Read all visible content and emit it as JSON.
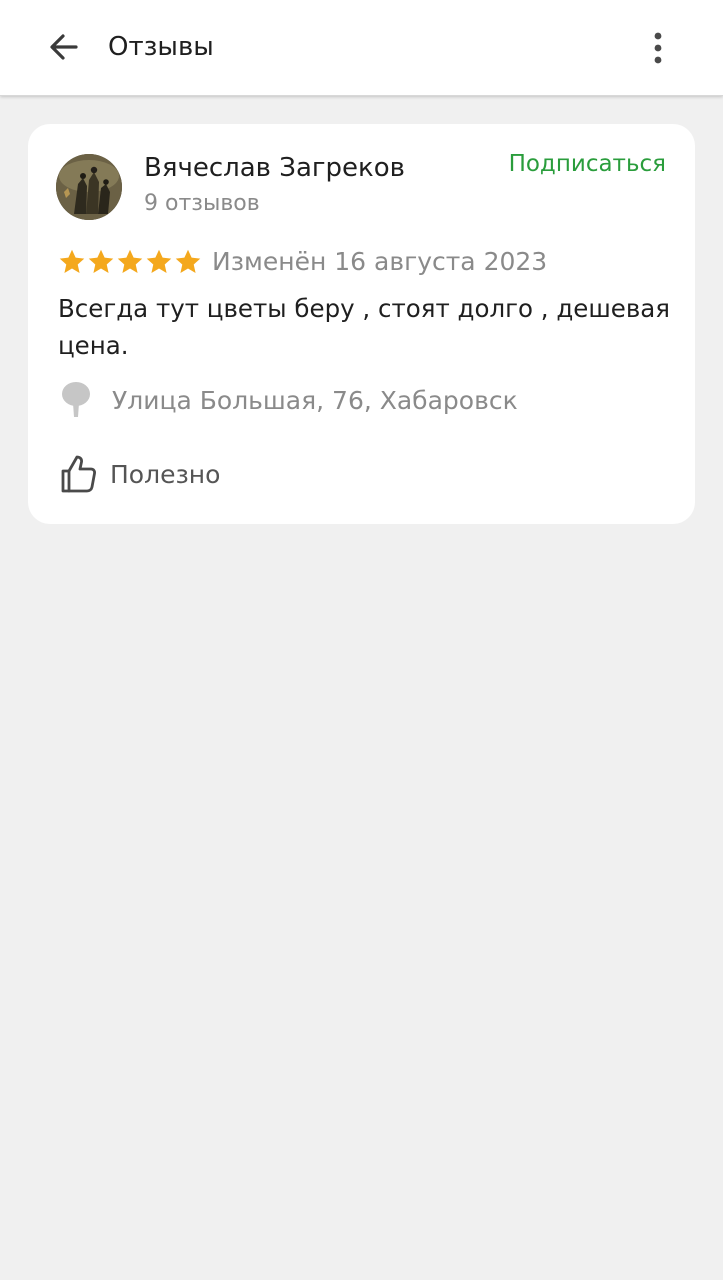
{
  "header": {
    "title": "Отзывы",
    "back_icon": "arrow-left-icon",
    "menu_icon": "more-vertical-icon"
  },
  "review": {
    "author": {
      "name": "Вячеслав Загреков",
      "reviews_count": "9 отзывов",
      "avatar": "user-avatar"
    },
    "subscribe_label": "Подписаться",
    "rating": 5,
    "rating_max": 5,
    "date": "Изменён 16 августа 2023",
    "text": "Всегда тут цветы беру , стоят долго , дешевая цена.",
    "organization": "Улица Большая, 76, Хабаровск",
    "useful_label": "Полезно"
  },
  "colors": {
    "accent_green": "#2a9d3c",
    "star_gold": "#f4a81d",
    "background": "#f0f0f0",
    "card": "#ffffff",
    "muted_text": "#8a8a8a"
  }
}
